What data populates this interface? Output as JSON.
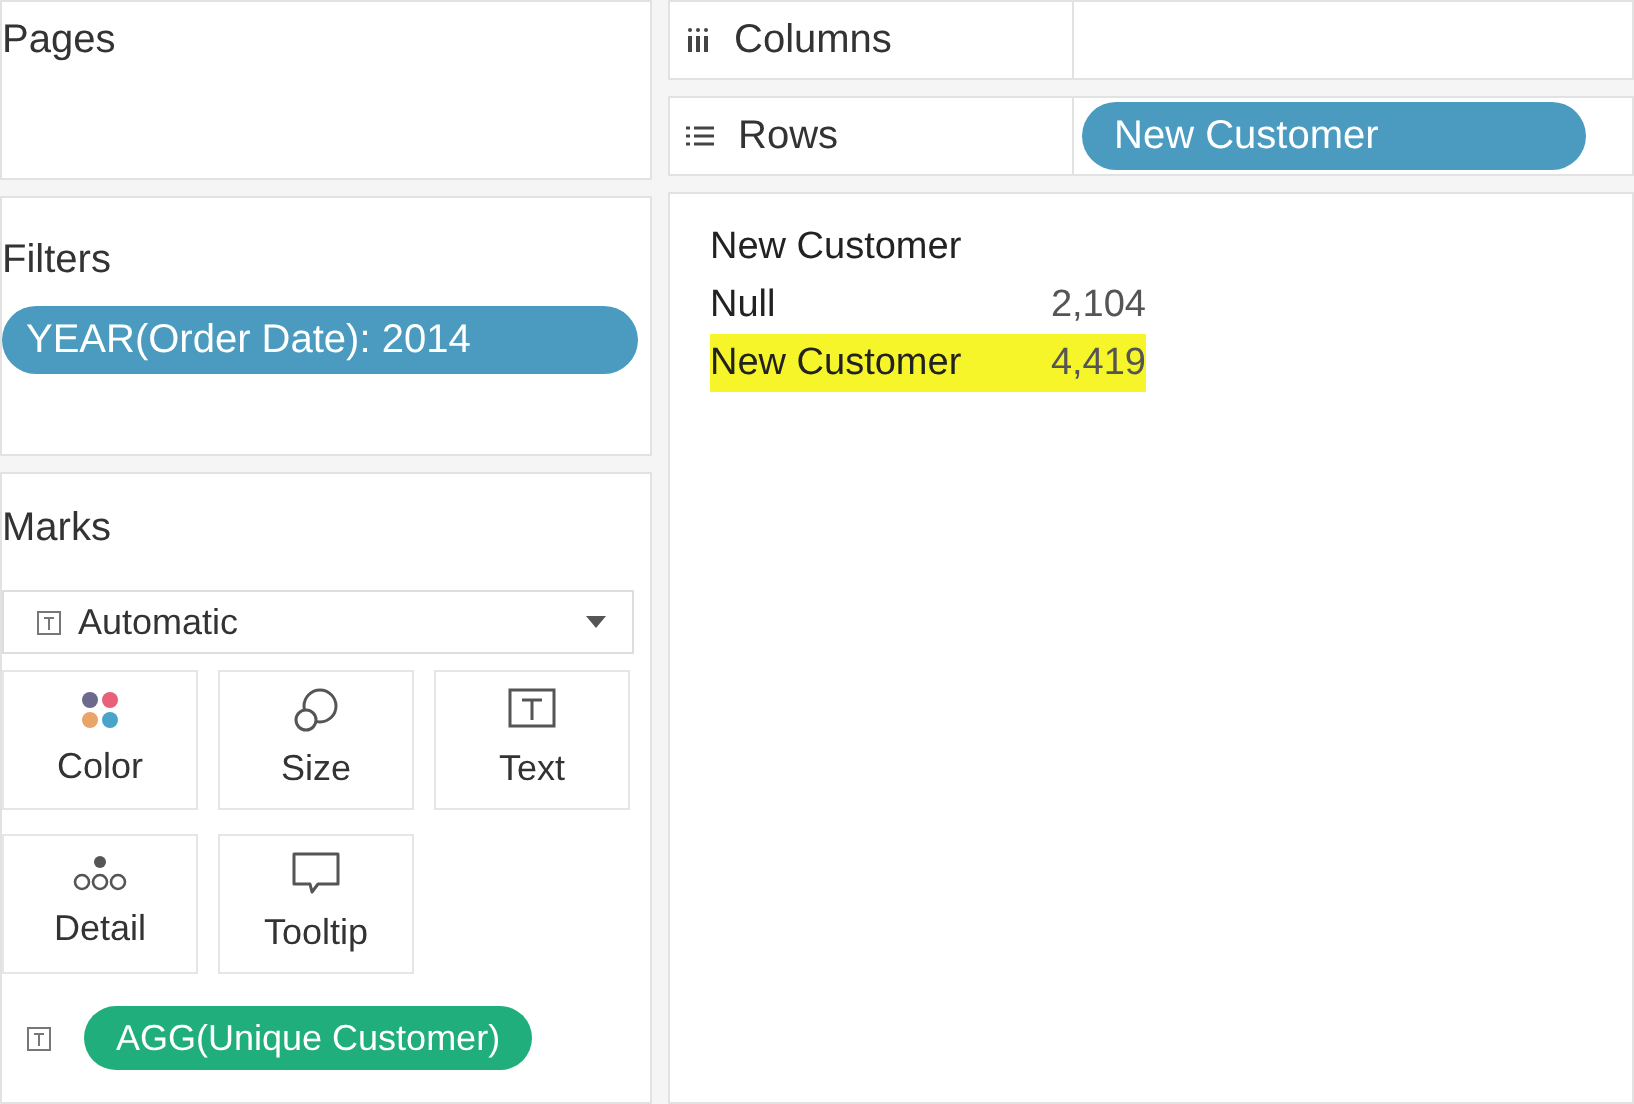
{
  "pages": {
    "title": "Pages"
  },
  "filters": {
    "title": "Filters",
    "pills": [
      {
        "label": "YEAR(Order Date): 2014",
        "kind": "dimension"
      }
    ]
  },
  "marks": {
    "title": "Marks",
    "mark_type": "Automatic",
    "cards": [
      {
        "label": "Color",
        "kind": "color"
      },
      {
        "label": "Size",
        "kind": "size"
      },
      {
        "label": "Text",
        "kind": "text"
      },
      {
        "label": "Detail",
        "kind": "detail"
      },
      {
        "label": "Tooltip",
        "kind": "tooltip"
      }
    ],
    "pills": [
      {
        "label": "AGG(Unique Customer)",
        "kind": "measure"
      }
    ]
  },
  "columns_shelf": {
    "label": "Columns"
  },
  "rows_shelf": {
    "label": "Rows",
    "pills": [
      {
        "label": "New Customer",
        "kind": "dimension"
      }
    ]
  },
  "view": {
    "header": "New Customer",
    "rows": [
      {
        "label": "Null",
        "value": "2,104",
        "highlighted": false
      },
      {
        "label": "New Customer",
        "value": "4,419",
        "highlighted": true
      }
    ]
  }
}
